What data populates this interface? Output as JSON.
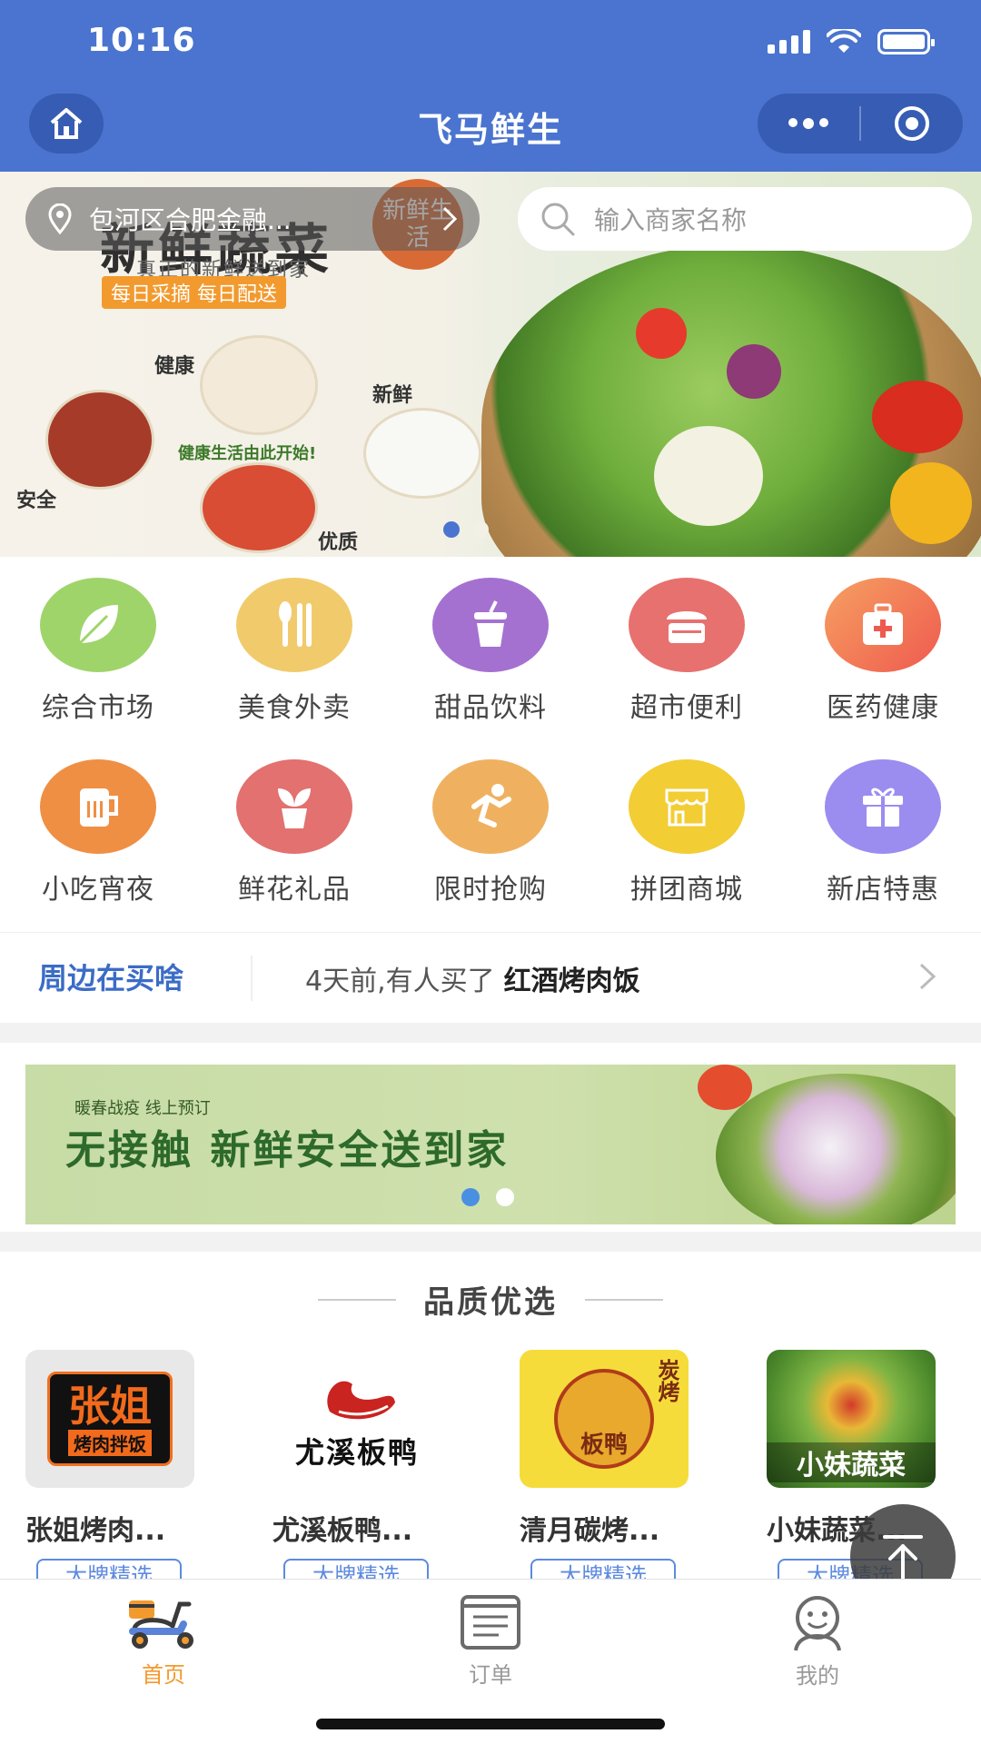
{
  "status_bar": {
    "time": "10:16"
  },
  "nav": {
    "title": "飞马鲜生"
  },
  "banner": {
    "location": "包河区合肥金融...",
    "search_placeholder": "输入商家名称",
    "headline": "新鲜蔬菜",
    "subline": "真正的新鲜送到家",
    "tagline": "每日采摘 每日配送",
    "badge": "新鲜生活",
    "labels": [
      "健康",
      "新鲜",
      "安全",
      "优质",
      "健康生活由此开始!"
    ],
    "active_slide": 1,
    "slide_count": 2
  },
  "categories": [
    {
      "label": "综合市场",
      "icon": "leaf-icon",
      "color": "#9fd46a"
    },
    {
      "label": "美食外卖",
      "icon": "cutlery-icon",
      "color": "#f1cb6b"
    },
    {
      "label": "甜品饮料",
      "icon": "drink-cup-icon",
      "color": "#a471d1"
    },
    {
      "label": "超市便利",
      "icon": "basket-icon",
      "color": "#e7716f"
    },
    {
      "label": "医药健康",
      "icon": "medical-kit-icon",
      "color": "#f27a5a"
    },
    {
      "label": "小吃宵夜",
      "icon": "mug-icon",
      "color": "#ef8f44"
    },
    {
      "label": "鲜花礼品",
      "icon": "plant-pot-icon",
      "color": "#e2716f"
    },
    {
      "label": "限时抢购",
      "icon": "running-icon",
      "color": "#efb160"
    },
    {
      "label": "拼团商城",
      "icon": "storefront-icon",
      "color": "#f2cd34"
    },
    {
      "label": "新店特惠",
      "icon": "gift-icon",
      "color": "#9b8cf0"
    }
  ],
  "ticker": {
    "label": "周边在买啥",
    "message": "4天前,有人买了",
    "item": "红酒烤肉饭"
  },
  "promo": {
    "small": "暖春战疫 线上预订",
    "big": "无接触 新鲜安全送到家",
    "active_slide": 1,
    "slide_count": 2
  },
  "section": {
    "title": "品质优选"
  },
  "shops": [
    {
      "name": "张姐烤肉...",
      "logo_text": "张姐",
      "logo_sub": "烤肉拌饭",
      "tag": "大牌精选"
    },
    {
      "name": "尤溪板鸭...",
      "logo_text": "尤溪板鸭",
      "tag": "大牌精选"
    },
    {
      "name": "清月碳烤...",
      "logo_text": "板鸭",
      "logo_side": "炭烤",
      "tag": "大牌精选"
    },
    {
      "name": "小妹蔬菜...",
      "logo_text": "小妹蔬菜",
      "tag": "大牌精选"
    }
  ],
  "tabs": [
    {
      "label": "首页",
      "icon": "scooter-icon",
      "active": true
    },
    {
      "label": "订单",
      "icon": "list-icon",
      "active": false
    },
    {
      "label": "我的",
      "icon": "user-icon",
      "active": false
    }
  ],
  "colors": {
    "primary": "#4a74cf",
    "tab_active": "#f39a2f",
    "tab_inactive": "#999999",
    "link": "#3b6cc6"
  }
}
